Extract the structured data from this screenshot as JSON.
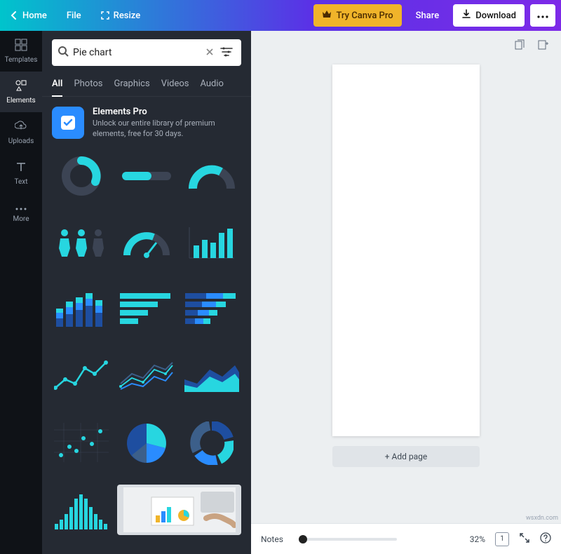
{
  "topbar": {
    "home": "Home",
    "file": "File",
    "resize": "Resize",
    "try_pro": "Try Canva Pro",
    "share": "Share",
    "download": "Download"
  },
  "rail": {
    "templates": "Templates",
    "elements": "Elements",
    "uploads": "Uploads",
    "text": "Text",
    "more": "More"
  },
  "search": {
    "value": "Pie chart"
  },
  "tabs": {
    "all": "All",
    "photos": "Photos",
    "graphics": "Graphics",
    "videos": "Videos",
    "audio": "Audio"
  },
  "promo": {
    "title": "Elements Pro",
    "subtitle": "Unlock our entire library of premium elements, free for 30 days."
  },
  "canvas": {
    "add_page": "+ Add page"
  },
  "status": {
    "notes": "Notes",
    "zoom": "32%",
    "page_count": "1"
  },
  "watermark": "wsxdn.com",
  "colors": {
    "teal": "#27d6e0",
    "blue": "#2a8cff",
    "darkblue": "#1e4ea0",
    "grey": "#3c4454"
  }
}
